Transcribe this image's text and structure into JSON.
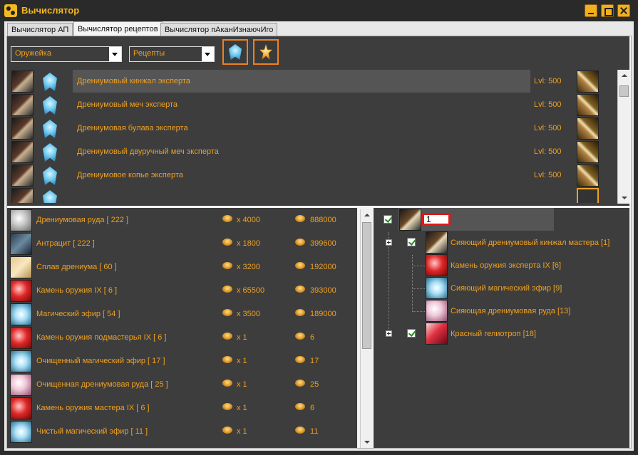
{
  "window": {
    "title": "Вычислятор"
  },
  "tabs": [
    {
      "label": "Вычислятор АП"
    },
    {
      "label": "Вычислятор рецептов"
    },
    {
      "label": "Вычислятор пАканИзнаючИго"
    }
  ],
  "filters": {
    "category": "Оружейка",
    "type": "Рецепты"
  },
  "recipes": [
    {
      "name": "Дрениумовый кинжал эксперта",
      "level": "Lvl: 500"
    },
    {
      "name": "Дрениумовый меч эксперта",
      "level": "Lvl: 500"
    },
    {
      "name": "Дрениумовая булава эксперта",
      "level": "Lvl: 500"
    },
    {
      "name": "Дрениумовый двуручный меч эксперта",
      "level": "Lvl: 500"
    },
    {
      "name": "Дрениумовое копье эксперта",
      "level": "Lvl: 500"
    }
  ],
  "materials": [
    {
      "name": "Дрениумовая руда  [ 222 ]",
      "qty": "x 4000",
      "total": "888000",
      "icon": "ore-icon"
    },
    {
      "name": "Антрацит  [ 222 ]",
      "qty": "x 1800",
      "total": "399600",
      "icon": "anthracite-icon"
    },
    {
      "name": "Сплав дрениума  [ 60 ]",
      "qty": "x 3200",
      "total": "192000",
      "icon": "alloy-icon"
    },
    {
      "name": "Камень оружия  IX [ 6 ]",
      "qty": "x 65500",
      "total": "393000",
      "icon": "gem-icon"
    },
    {
      "name": "Магический эфир  [ 54 ]",
      "qty": "x 3500",
      "total": "189000",
      "icon": "ether-icon"
    },
    {
      "name": "Камень оружия подмастерья  IX [ 6 ]",
      "qty": "x 1",
      "total": "6",
      "icon": "gem-icon"
    },
    {
      "name": "Очищенный магический эфир  [ 17 ]",
      "qty": "x 1",
      "total": "17",
      "icon": "ether-icon"
    },
    {
      "name": "Очищенная дрениумовая руда  [ 25 ]",
      "qty": "x 1",
      "total": "25",
      "icon": "ore-icon"
    },
    {
      "name": "Камень оружия мастера  IX [ 6 ]",
      "qty": "x 1",
      "total": "6",
      "icon": "gem-icon"
    },
    {
      "name": "Чистый магический эфир  [ 11 ]",
      "qty": "x 1",
      "total": "11",
      "icon": "ether-icon"
    }
  ],
  "tree": {
    "root_quantity": "1",
    "nodes": [
      {
        "label": "Сияющий дрениумовый кинжал мастера  [1]"
      },
      {
        "label": "Камень оружия эксперта  IX [6]"
      },
      {
        "label": "Сияющий магический эфир  [9]"
      },
      {
        "label": "Сияющая дрениумовая руда  [13]"
      },
      {
        "label": "Красный гелиотроп  [18]"
      }
    ]
  }
}
